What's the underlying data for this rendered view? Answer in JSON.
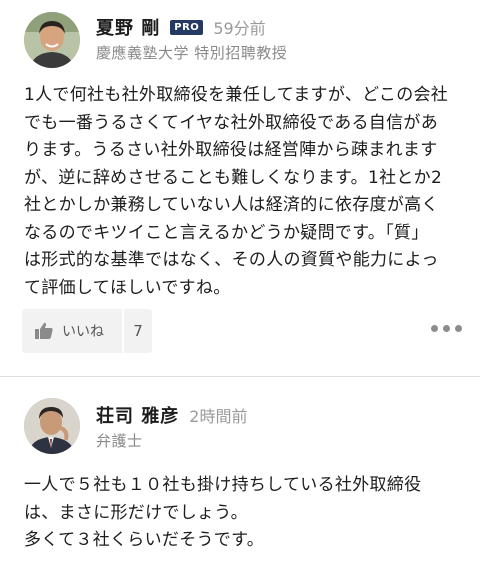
{
  "comments": [
    {
      "name": "夏野 剛",
      "badge": "PRO",
      "time": "59分前",
      "title": "慶應義塾大学 特別招聘教授",
      "lines": [
        "1人で何社も社外取締役を兼任してますが、どこの会社",
        "でも一番うるさくてイヤな社外取締役である自信があ",
        "ります。うるさい社外取締役は経営陣から疎まれます",
        "が、逆に辞めさせることも難しくなります。1社とか2",
        "社とかしか兼務していない人は経済的に依存度が高く",
        "なるのでキツイこと言えるかどうか疑問です。「質」",
        "は形式的な基準ではなく、その人の資質や能力によっ",
        "て評価してほしいですね。"
      ],
      "like_label": "いいね",
      "like_count": "7",
      "like_icon": "thumbs-up-icon",
      "more_icon": "more-dots-icon"
    },
    {
      "name": "荘司 雅彦",
      "time": "2時間前",
      "title": "弁護士",
      "lines": [
        "一人で５社も１０社も掛け持ちしている社外取締役",
        "は、まさに形だけでしょう。",
        "多くて３社くらいだそうです。"
      ]
    }
  ],
  "colors": {
    "badge": "#243a63",
    "muted": "#9a9a9a",
    "button_bg": "#f2f2f2"
  }
}
